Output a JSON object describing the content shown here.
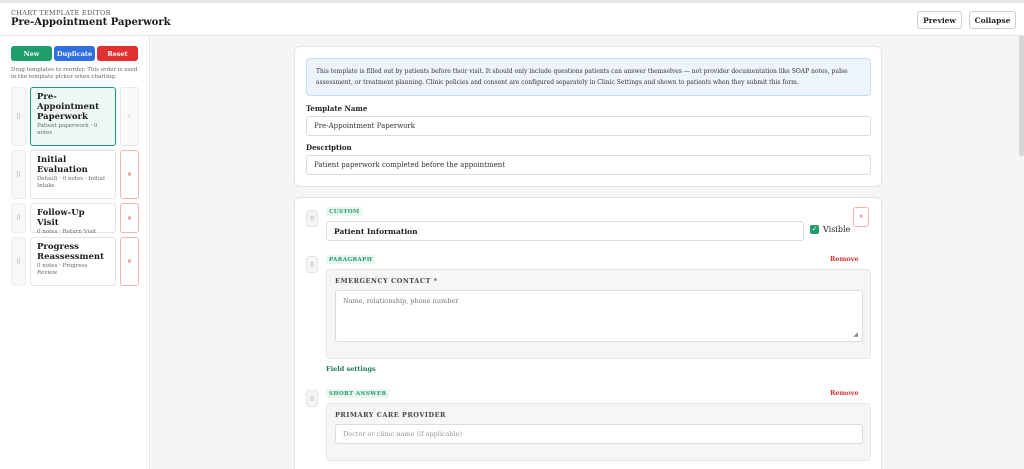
{
  "header": {
    "eyebrow": "CHART TEMPLATE EDITOR",
    "title": "Pre-Appointment Paperwork",
    "preview_label": "Preview",
    "collapse_label": "Collapse"
  },
  "sidebar": {
    "new_label": "New",
    "duplicate_label": "Duplicate",
    "reset_label": "Reset",
    "hint": "Drag templates to reorder. This order is used in the template picker when charting.",
    "handle_glyph": "⠿",
    "delete_glyph": "×",
    "templates": [
      {
        "name": "Pre-Appointment Paperwork",
        "meta": "Patient paperwork · 0 notes",
        "active": true
      },
      {
        "name": "Initial Evaluation",
        "meta": "Default · 0 notes · Initial Intake",
        "active": false
      },
      {
        "name": "Follow-Up Visit",
        "meta": "0 notes · Return Visit",
        "active": false
      },
      {
        "name": "Progress Reassessment",
        "meta": "0 notes · Progress Review",
        "active": false
      }
    ]
  },
  "meta_card": {
    "notice": "This template is filled out by patients before their visit. It should only include questions patients can answer themselves — not provider documentation like SOAP notes, pulse assessment, or treatment planning. Clinic policies and consent are configured separately in Clinic Settings and shown to patients when they submit this form.",
    "name_label": "Template Name",
    "name_value": "Pre-Appointment Paperwork",
    "description_label": "Description",
    "description_value": "Patient paperwork completed before the appointment"
  },
  "fields_card": {
    "section_badge": "CUSTOM",
    "section_title": "Patient Information",
    "visible_label": "Visible",
    "remove_label": "Remove",
    "field_settings_label": "Field settings",
    "fields": [
      {
        "type_badge": "PARAGRAPH",
        "label": "EMERGENCY CONTACT *",
        "placeholder": "Name, relationship, phone number"
      },
      {
        "type_badge": "SHORT ANSWER",
        "label": "PRIMARY CARE PROVIDER",
        "placeholder": "Doctor or clinic name (if applicable)"
      }
    ]
  },
  "colors": {
    "accent_green": "#1f9d6a",
    "accent_blue": "#2f6fe0",
    "danger_red": "#e03131"
  }
}
